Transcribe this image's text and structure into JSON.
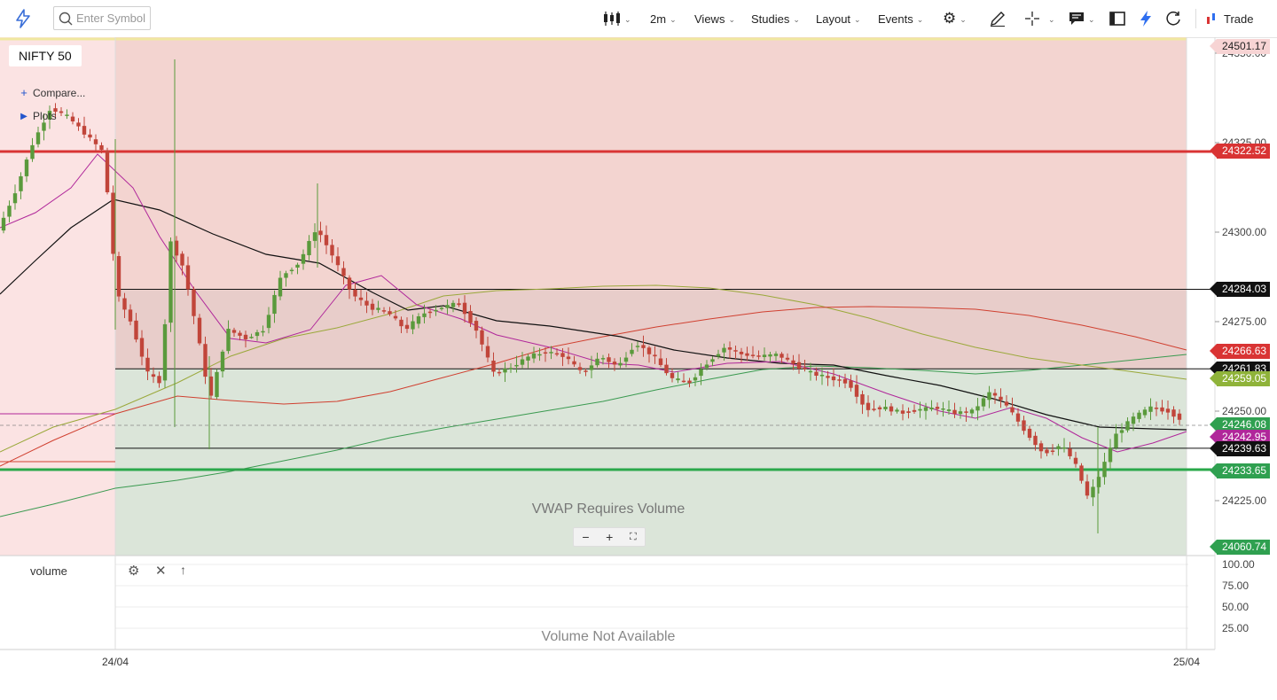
{
  "toolbar": {
    "search_placeholder": "Enter Symbol",
    "interval": "2m",
    "views": "Views",
    "studies": "Studies",
    "layout": "Layout",
    "events": "Events",
    "trade": "Trade",
    "icons": [
      "logo-bolt-icon",
      "search-icon",
      "candlestick-icon",
      "gear-icon",
      "pencil-icon",
      "crosshair-icon",
      "comment-icon",
      "panel-icon",
      "bolt-icon",
      "refresh-icon",
      "trade-icon"
    ]
  },
  "chart": {
    "symbol": "NIFTY 50",
    "compare_label": "Compare...",
    "plots_label": "Plots",
    "vwap_message": "VWAP Requires Volume",
    "volume_label": "volume",
    "volume_message": "Volume Not Available",
    "date_labels": [
      "24/04",
      "25/04"
    ],
    "colors": {
      "up": "#5a9a3c",
      "down": "#c1453a",
      "resistance": "#e03030",
      "support": "#2aa84a",
      "ma_black": "#111111",
      "ma_magenta": "#b0279a",
      "ma_olive": "#9aa83a",
      "ma_red": "#d04030",
      "ma_green": "#3a9a50"
    }
  },
  "chart_data": {
    "type": "candlestick",
    "y_axis_labels": [
      "24350.00",
      "24325.00",
      "24300.00",
      "24275.00",
      "24250.00",
      "24225.00"
    ],
    "volume_axis_labels": [
      "100.00",
      "75.00",
      "50.00",
      "25.00"
    ],
    "price_tags": [
      {
        "value": "24501.17",
        "bg": "#f7d4d4",
        "fg": "#222222"
      },
      {
        "value": "24322.52",
        "bg": "#d93434",
        "fg": "#ffffff"
      },
      {
        "value": "24284.03",
        "bg": "#111111",
        "fg": "#ffffff"
      },
      {
        "value": "24266.63",
        "bg": "#d93434",
        "fg": "#ffffff"
      },
      {
        "value": "24261.83",
        "bg": "#111111",
        "fg": "#ffffff"
      },
      {
        "value": "24259.05",
        "bg": "#8fb33a",
        "fg": "#ffffff"
      },
      {
        "value": "24246.08",
        "bg": "#2fa050",
        "fg": "#ffffff"
      },
      {
        "value": "24242.95",
        "bg": "#b0279a",
        "fg": "#ffffff"
      },
      {
        "value": "24239.63",
        "bg": "#111111",
        "fg": "#ffffff"
      },
      {
        "value": "24233.65",
        "bg": "#2fa050",
        "fg": "#ffffff"
      },
      {
        "value": "24060.74",
        "bg": "#2fa050",
        "fg": "#ffffff"
      }
    ],
    "horizontal_levels": [
      24322.52,
      24284.03,
      24261.83,
      24239.63,
      24233.65
    ],
    "ylim": [
      24218,
      24360
    ]
  }
}
